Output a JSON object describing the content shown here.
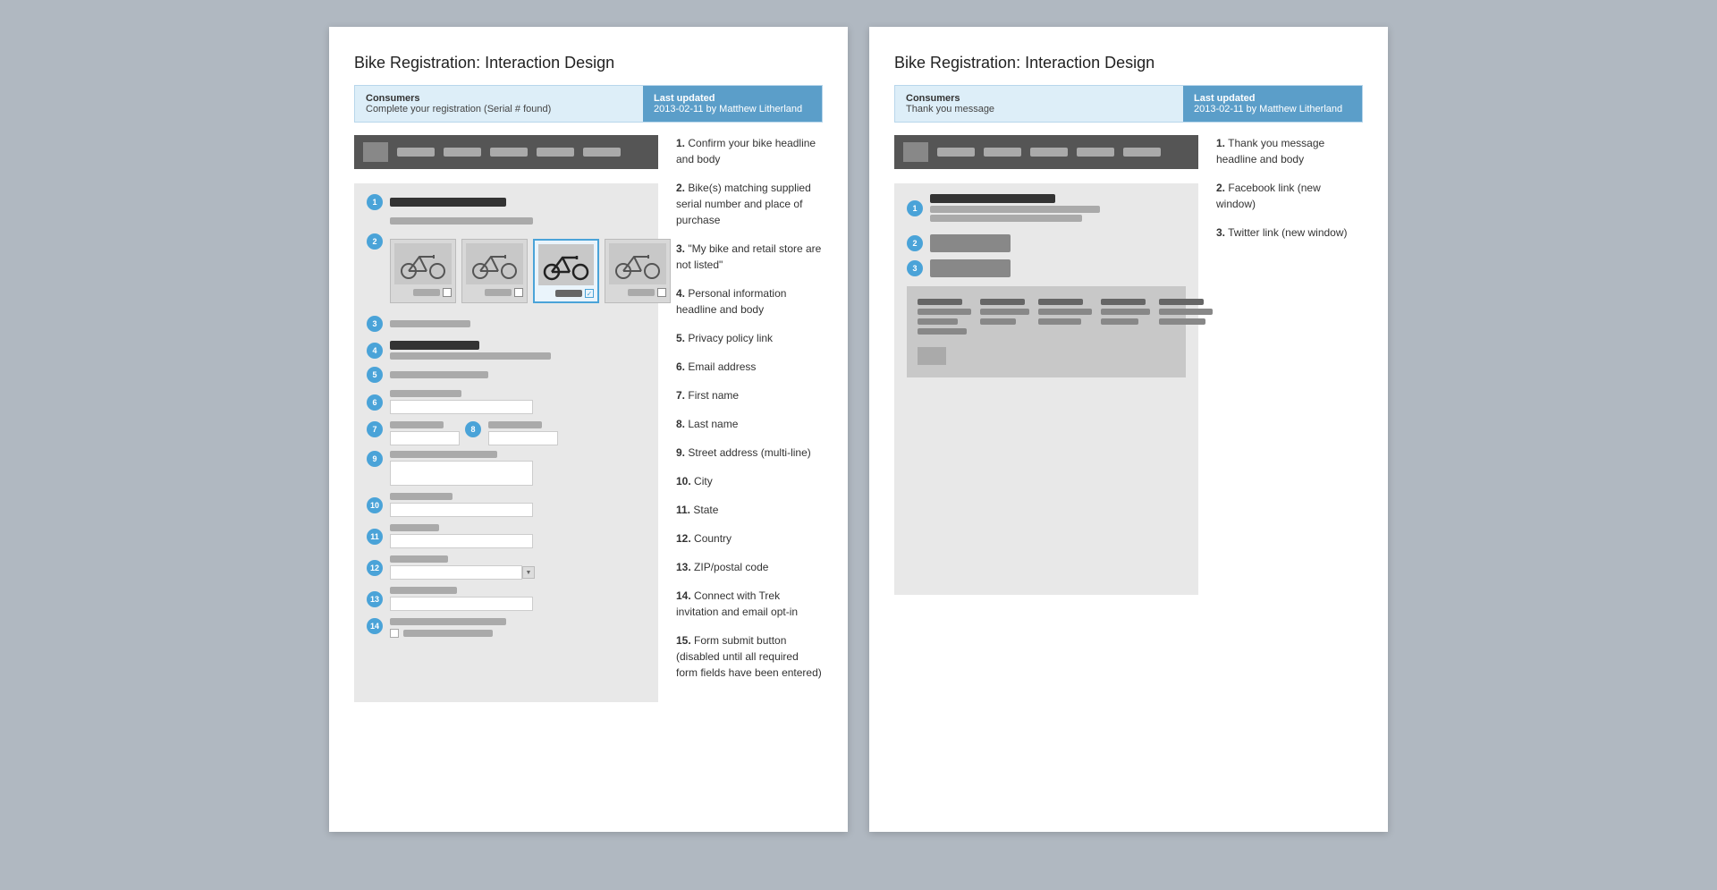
{
  "left_panel": {
    "title": "Bike Registration:",
    "title_sub": "Interaction Design",
    "info_bar": {
      "left_label": "Consumers",
      "left_value": "Complete your registration (Serial # found)",
      "right_label": "Last updated",
      "right_value": "2013-02-11 by Matthew Litherland"
    },
    "notes": [
      {
        "num": "1.",
        "text": "Confirm your bike headline and body"
      },
      {
        "num": "2.",
        "text": "Bike(s) matching supplied serial number and place of purchase"
      },
      {
        "num": "3.",
        "text": "\"My bike and retail store are not listed\""
      },
      {
        "num": "4.",
        "text": "Personal information headline and body"
      },
      {
        "num": "5.",
        "text": "Privacy policy link"
      },
      {
        "num": "6.",
        "text": "Email address"
      },
      {
        "num": "7.",
        "text": "First name"
      },
      {
        "num": "8.",
        "text": "Last name"
      },
      {
        "num": "9.",
        "text": "Street address (multi-line)"
      },
      {
        "num": "10.",
        "text": "City"
      },
      {
        "num": "11.",
        "text": "State"
      },
      {
        "num": "12.",
        "text": "Country"
      },
      {
        "num": "13.",
        "text": "ZIP/postal code"
      },
      {
        "num": "14.",
        "text": "Connect with Trek invitation and email opt-in"
      },
      {
        "num": "15.",
        "text": "Form submit button (disabled until all required form fields have been entered)"
      }
    ],
    "circles": [
      "1",
      "2",
      "3",
      "4",
      "5",
      "6",
      "7",
      "8",
      "9",
      "10",
      "11",
      "12",
      "13",
      "14"
    ]
  },
  "right_panel": {
    "title": "Bike Registration:",
    "title_sub": "Interaction Design",
    "info_bar": {
      "left_label": "Consumers",
      "left_value": "Thank you message",
      "right_label": "Last updated",
      "right_value": "2013-02-11 by Matthew Litherland"
    },
    "notes": [
      {
        "num": "1.",
        "text": "Thank you message headline and body"
      },
      {
        "num": "2.",
        "text": "Facebook link (new window)"
      },
      {
        "num": "3.",
        "text": "Twitter link (new window)"
      }
    ]
  }
}
